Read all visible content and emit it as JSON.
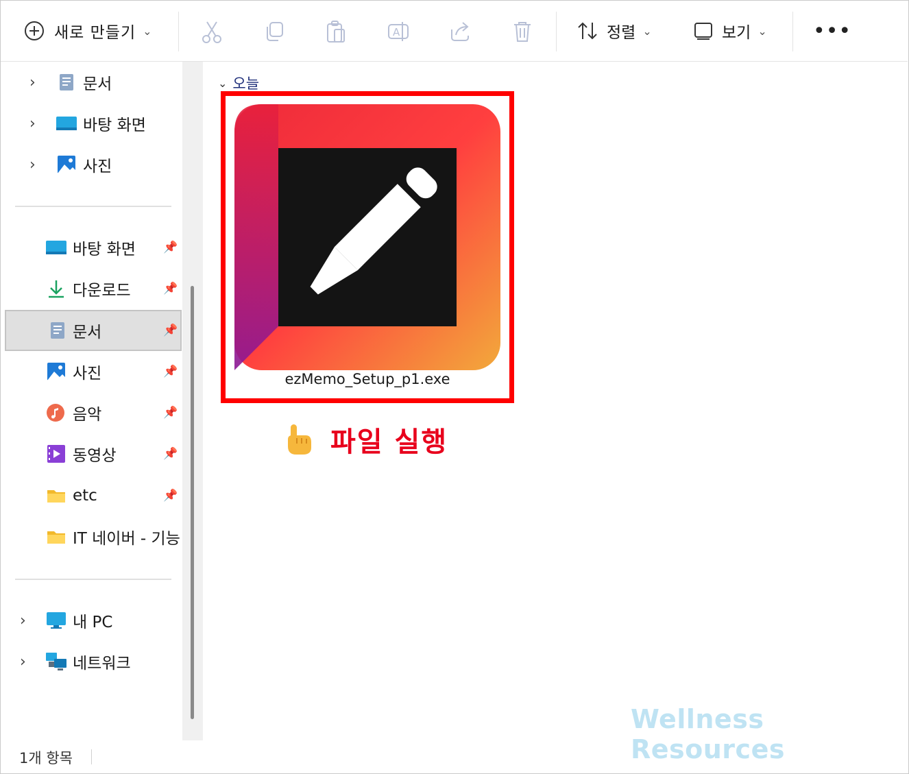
{
  "toolbar": {
    "new_label": "새로 만들기",
    "sort_label": "정렬",
    "view_label": "보기",
    "more_label": "•••"
  },
  "sidebar": {
    "top_items": [
      {
        "label": "문서",
        "icon": "documents-icon"
      },
      {
        "label": "바탕 화면",
        "icon": "desktop-icon"
      },
      {
        "label": "사진",
        "icon": "pictures-icon"
      }
    ],
    "quick_access": [
      {
        "label": "바탕 화면",
        "icon": "desktop-icon",
        "pinned": true
      },
      {
        "label": "다운로드",
        "icon": "download-icon",
        "pinned": true
      },
      {
        "label": "문서",
        "icon": "documents-icon",
        "pinned": true,
        "selected": true
      },
      {
        "label": "사진",
        "icon": "pictures-icon",
        "pinned": true
      },
      {
        "label": "음악",
        "icon": "music-icon",
        "pinned": true
      },
      {
        "label": "동영상",
        "icon": "videos-icon",
        "pinned": true
      },
      {
        "label": "etc",
        "icon": "folder-icon",
        "pinned": true
      },
      {
        "label": "IT 네이버 - 기능",
        "icon": "folder-icon",
        "pinned": false
      }
    ],
    "bottom_items": [
      {
        "label": "내 PC",
        "icon": "this-pc-icon"
      },
      {
        "label": "네트워크",
        "icon": "network-icon"
      }
    ]
  },
  "main": {
    "group_header": "오늘",
    "file_name": "ezMemo_Setup_p1.exe"
  },
  "annotation": {
    "text": "파일 실행",
    "color": "#e8001c"
  },
  "watermark": "Wellness Resources",
  "status": {
    "count": "1개 항목"
  }
}
